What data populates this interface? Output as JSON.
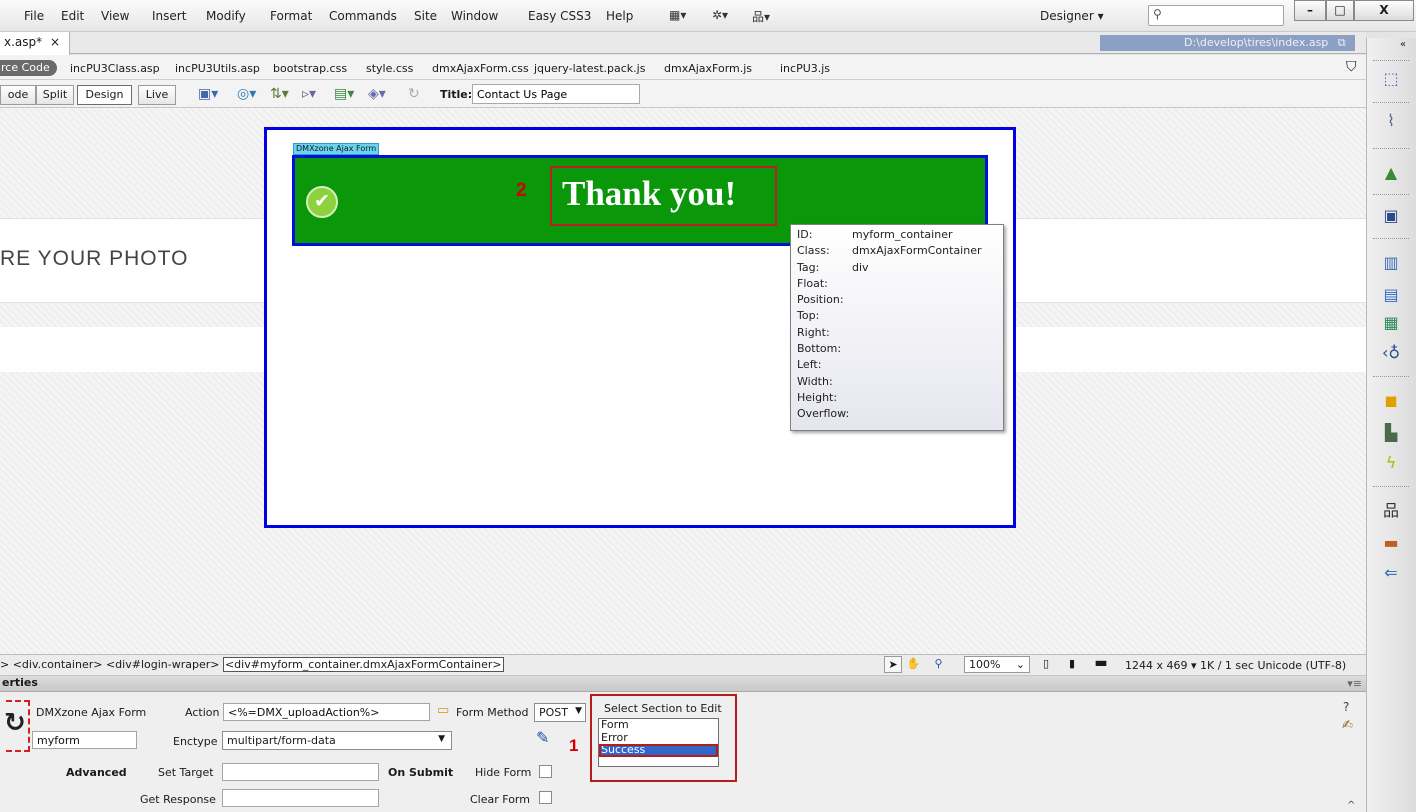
{
  "menu": {
    "items": [
      "File",
      "Edit",
      "View",
      "Insert",
      "Modify",
      "Format",
      "Commands",
      "Site",
      "Window",
      "Easy CSS3",
      "Help"
    ],
    "workspace": "Designer",
    "search_placeholder": "",
    "win_minimize": "–",
    "win_maximize": "□",
    "win_close": "X"
  },
  "document": {
    "tab_label": "x.asp*",
    "tab_close": "×",
    "path": "D:\\develop\\tires\\index.asp",
    "source_code": "rce Code",
    "related_files": [
      "incPU3Class.asp",
      "incPU3Utils.asp",
      "bootstrap.css",
      "style.css",
      "dmxAjaxForm.css",
      "jquery-latest.pack.js",
      "dmxAjaxForm.js",
      "incPU3.js"
    ]
  },
  "viewbar": {
    "code": "ode",
    "split": "Split",
    "design": "Design",
    "live": "Live",
    "title_label": "Title:",
    "title_value": "Contact Us Page"
  },
  "canvas": {
    "photo_text": "RE YOUR PHOTO",
    "form_label": "DMXzone Ajax Form",
    "thank_you": "Thank you!",
    "callout_1": "1",
    "callout_2": "2",
    "check_icon": "✔"
  },
  "tooltip": {
    "rows": [
      {
        "k": "ID:",
        "v": "myform_container"
      },
      {
        "k": "Class:",
        "v": "dmxAjaxFormContainer"
      },
      {
        "k": "Tag:",
        "v": "div"
      },
      {
        "k": "Float:",
        "v": ""
      },
      {
        "k": "Position:",
        "v": ""
      },
      {
        "k": "Top:",
        "v": ""
      },
      {
        "k": "Right:",
        "v": ""
      },
      {
        "k": "Bottom:",
        "v": ""
      },
      {
        "k": "Left:",
        "v": ""
      },
      {
        "k": "Width:",
        "v": ""
      },
      {
        "k": "Height:",
        "v": ""
      },
      {
        "k": "Overflow:",
        "v": ""
      }
    ]
  },
  "status": {
    "tag_prefix": "> <div.container> <div#login-wraper>",
    "tag_selected": "<div#myform_container.dmxAjaxFormContainer>",
    "zoom": "100%",
    "info": "1244 x 469 ▾  1K / 1 sec  Unicode (UTF-8)"
  },
  "properties": {
    "header": "erties",
    "component": "DMXzone Ajax Form",
    "form_name": "myform",
    "action_label": "Action",
    "action_value": "<%=DMX_uploadAction%>",
    "enctype_label": "Enctype",
    "enctype_value": "multipart/form-data",
    "method_label": "Form Method",
    "method_value": "POST",
    "advanced": "Advanced",
    "set_target": "Set Target",
    "on_submit": "On Submit",
    "hide_form": "Hide Form",
    "get_response": "Get Response",
    "clear_form": "Clear Form",
    "section_title": "Select Section to Edit",
    "sections": [
      "Form",
      "Error",
      "Success"
    ],
    "selected_section": "Success"
  }
}
